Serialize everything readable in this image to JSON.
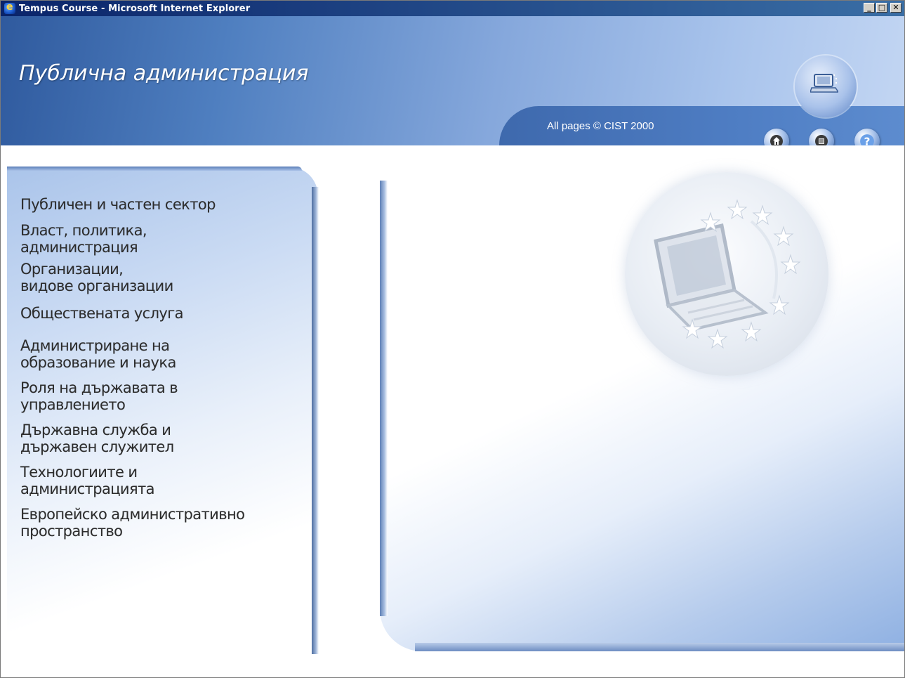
{
  "window": {
    "title": "Tempus Course - Microsoft Internet Explorer",
    "controls": {
      "minimize": "_",
      "maximize": "□",
      "close": "✕"
    }
  },
  "header": {
    "title": "Публична администрация",
    "copyright": "All pages © CIST 2000",
    "nav_icons": [
      "home-icon",
      "contents-icon",
      "help-icon"
    ]
  },
  "menu": {
    "items": [
      "Публичен и частен сектор",
      "Власт, политика,\nадминистрация",
      "Организации,\nвидове  организации",
      "Обществената услуга",
      "Администриране на\nобразование и наука",
      "Роля на държавата в\nуправлението",
      "Държавна служба и\nдържавен служител",
      "Технологиите и\nадминистрацията",
      "Европейско административно\nпространство"
    ]
  },
  "colors": {
    "titlebar_start": "#0a246a",
    "banner_accent": "#2f5a9e",
    "menu_text": "#2c2c2c"
  }
}
